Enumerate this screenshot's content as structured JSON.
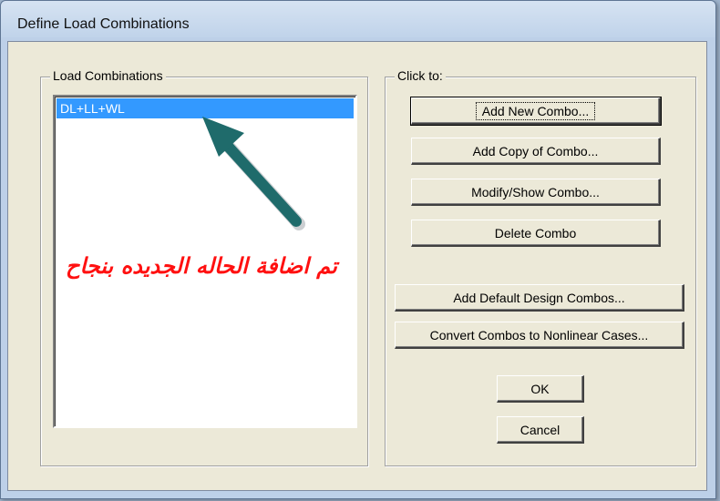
{
  "window": {
    "title": "Define Load Combinations"
  },
  "left_group": {
    "label": "Load Combinations",
    "items": [
      "DL+LL+WL"
    ]
  },
  "right_group": {
    "label": "Click to:",
    "buttons": {
      "add_new": "Add New Combo...",
      "add_copy": "Add Copy of Combo...",
      "modify": "Modify/Show Combo...",
      "delete": "Delete Combo",
      "add_default": "Add Default Design Combos...",
      "convert": "Convert Combos to Nonlinear Cases..."
    }
  },
  "ok_label": "OK",
  "cancel_label": "Cancel",
  "annotation": {
    "text": "تم اضافة الحاله الجديده بنجاح",
    "text_color": "#ff1010",
    "arrow_color": "#1f6b6b"
  },
  "colors": {
    "selection": "#3399ff"
  }
}
